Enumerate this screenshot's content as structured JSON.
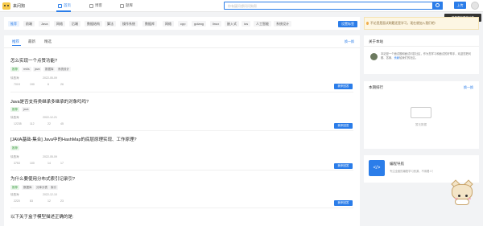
{
  "app": {
    "site_name": "来问狗"
  },
  "nav": [
    {
      "label": "首页",
      "active": true
    },
    {
      "label": "博客",
      "active": false
    },
    {
      "label": "题库",
      "active": false
    }
  ],
  "search": {
    "placeholder": "你有疑问想问问狗帮"
  },
  "header": {
    "upload_label": "上传",
    "tooltip": "登录享有更多功能"
  },
  "tags": [
    "推荐",
    "前端",
    "Java",
    "网络",
    "后端",
    "数据结构",
    "算法",
    "操作系统",
    "数据库",
    "网络",
    "cpp",
    "golang",
    "linux",
    "嵌入式",
    "ios",
    "人工智能",
    "系统设计"
  ],
  "tag_manage_label": "设置标签",
  "feed": {
    "tabs": [
      "推荐",
      "最新",
      "精选"
    ],
    "refresh_label": "换一换",
    "answer_label": "我来回答",
    "questions": [
      {
        "title": "怎么实现一个点赞功能?",
        "tags": [
          "推荐",
          "redis",
          "java",
          "数据库",
          "系统设计"
        ],
        "author": "徐昌海",
        "time": "2022-05-09",
        "views": "7015",
        "likes": "190",
        "favorites": "6",
        "comments": "26"
      },
      {
        "title": "Java是否支持类继承多继承的对象吗吗?",
        "tags": [
          "推荐",
          "java"
        ],
        "author": "徐昌海",
        "time": "2022-12-21",
        "views": "12235",
        "likes": "112",
        "favorites": "22",
        "comments": "45"
      },
      {
        "title": "[JAVA基础-集合] Java中的HashMap的底层原理实现、工作原理?",
        "tags": [
          "推荐"
        ],
        "author": "徐昌海",
        "time": "2022-05-09",
        "views": "3753",
        "likes": "100",
        "favorites": "14",
        "comments": "17"
      },
      {
        "title": "为什么要使用分布式索引记录引?",
        "tags": [
          "推荐",
          "数据库",
          "分库分表",
          "索引"
        ],
        "author": "徐昌海",
        "time": "2022-12-10",
        "views": "2220",
        "likes": "83",
        "favorites": "12",
        "comments": "23"
      },
      {
        "title": "以下关于盒子模型描述正确的是:",
        "tags": [],
        "author": "",
        "time": "",
        "views": "",
        "likes": "",
        "favorites": "",
        "comments": ""
      }
    ]
  },
  "notice": {
    "text": "不论您是面试刷题还是学习，现在就加入我们吧!"
  },
  "about": {
    "title": "关于本站",
    "text_before": "本站是一个面试题和面试问答社区，作为您学习和面试的好帮手，欢迎您把问题、答案、",
    "link": "贡献",
    "text_after": "给我们的社区。"
  },
  "ranking": {
    "title": "本期排行",
    "refresh_label": "换一换",
    "empty_text": "暂无数据"
  },
  "promo": {
    "icon_text": "</>",
    "title": "编程导航",
    "desc": "专注全面的编程学习资源，不用看人！"
  }
}
